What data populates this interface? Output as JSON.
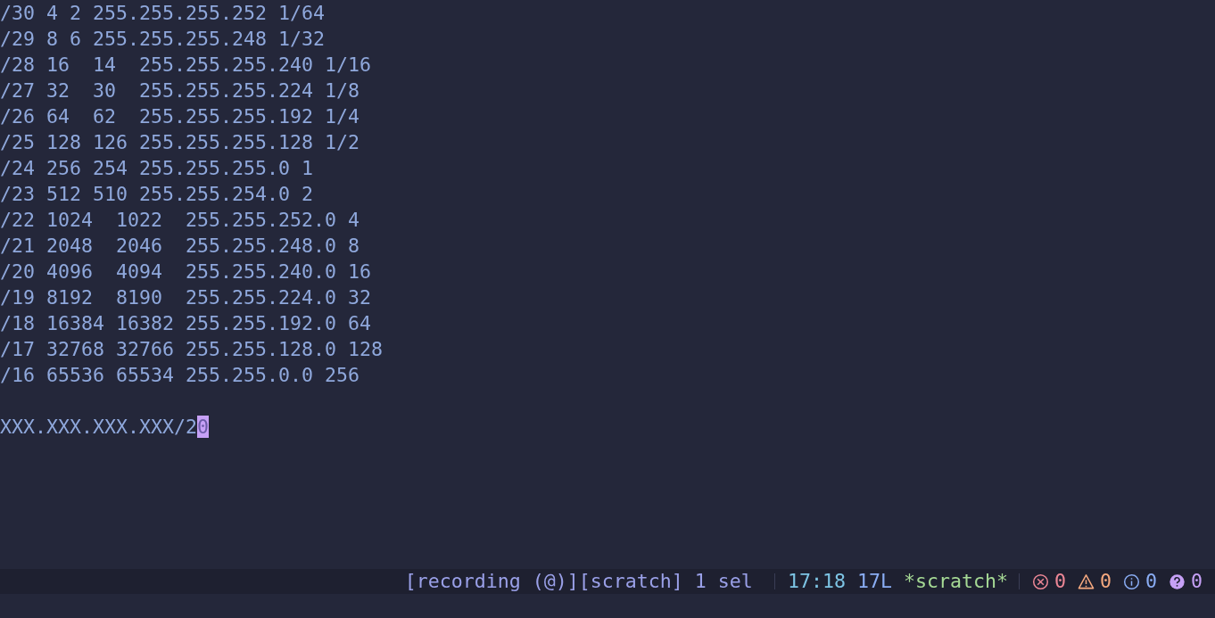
{
  "editor": {
    "lines": [
      "/30 4 2 255.255.255.252 1/64",
      "/29 8 6 255.255.255.248 1/32",
      "/28 16  14  255.255.255.240 1/16",
      "/27 32  30  255.255.255.224 1/8",
      "/26 64  62  255.255.255.192 1/4",
      "/25 128 126 255.255.255.128 1/2",
      "/24 256 254 255.255.255.0 1",
      "/23 512 510 255.255.254.0 2",
      "/22 1024  1022  255.255.252.0 4",
      "/21 2048  2046  255.255.248.0 8",
      "/20 4096  4094  255.255.240.0 16",
      "/19 8192  8190  255.255.224.0 32",
      "/18 16384 16382 255.255.192.0 64",
      "/17 32768 32766 255.255.128.0 128",
      "/16 65536 65534 255.255.0.0 256"
    ],
    "cursor_line": {
      "text": "XXX.XXX.XXX.XXX/2",
      "cursor_char": "0"
    }
  },
  "status_bar": {
    "mode": "[recording (@)][scratch] 1 sel",
    "position": "17:18",
    "line_count": "17L",
    "buffer": "*scratch*",
    "diagnostics": [
      {
        "kind": "error",
        "count": "0",
        "color": "#ed8796"
      },
      {
        "kind": "warning",
        "count": "0",
        "color": "#f5a97f"
      },
      {
        "kind": "info",
        "count": "0",
        "color": "#8aadf4"
      },
      {
        "kind": "hint",
        "count": "0",
        "color": "#c6a0f6"
      }
    ]
  }
}
